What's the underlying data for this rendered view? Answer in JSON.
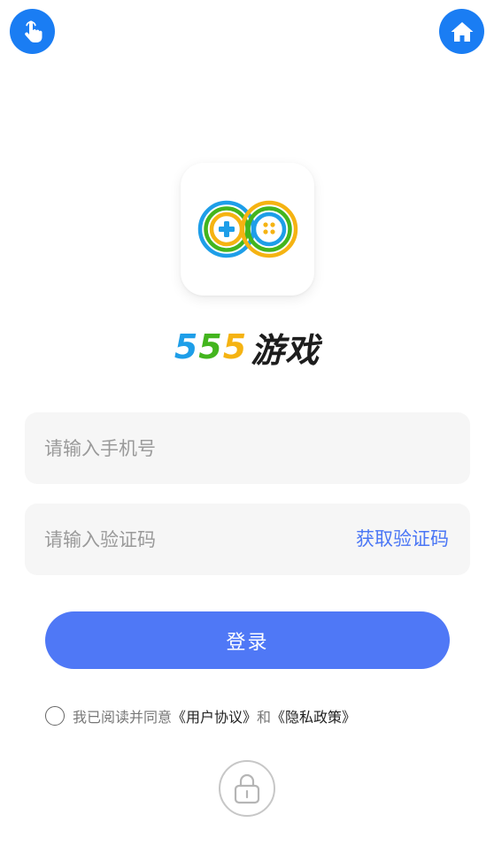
{
  "header": {
    "left_icon": "touch-hand-icon",
    "right_icon": "home-icon"
  },
  "brand": {
    "logo_icon": "game-controller-infinity-logo",
    "digits": [
      "5",
      "5",
      "5"
    ],
    "text": "游戏",
    "colors": {
      "d1": "#1e9ee8",
      "d2": "#43b51e",
      "d3": "#f5b312",
      "text": "#1d1d1d"
    }
  },
  "form": {
    "phone_placeholder": "请输入手机号",
    "code_placeholder": "请输入验证码",
    "get_code_label": "获取验证码",
    "login_label": "登录"
  },
  "agreement": {
    "prefix": "我已阅读并同意",
    "user_agreement": "《用户协议》",
    "conjunction": "和",
    "privacy_policy": "《隐私政策》"
  },
  "footer": {
    "icon": "lock-icon"
  },
  "colors": {
    "primary": "#4f78f6",
    "header_button": "#1a7df3",
    "link": "#4a76f5",
    "field_bg": "#f6f6f6"
  }
}
